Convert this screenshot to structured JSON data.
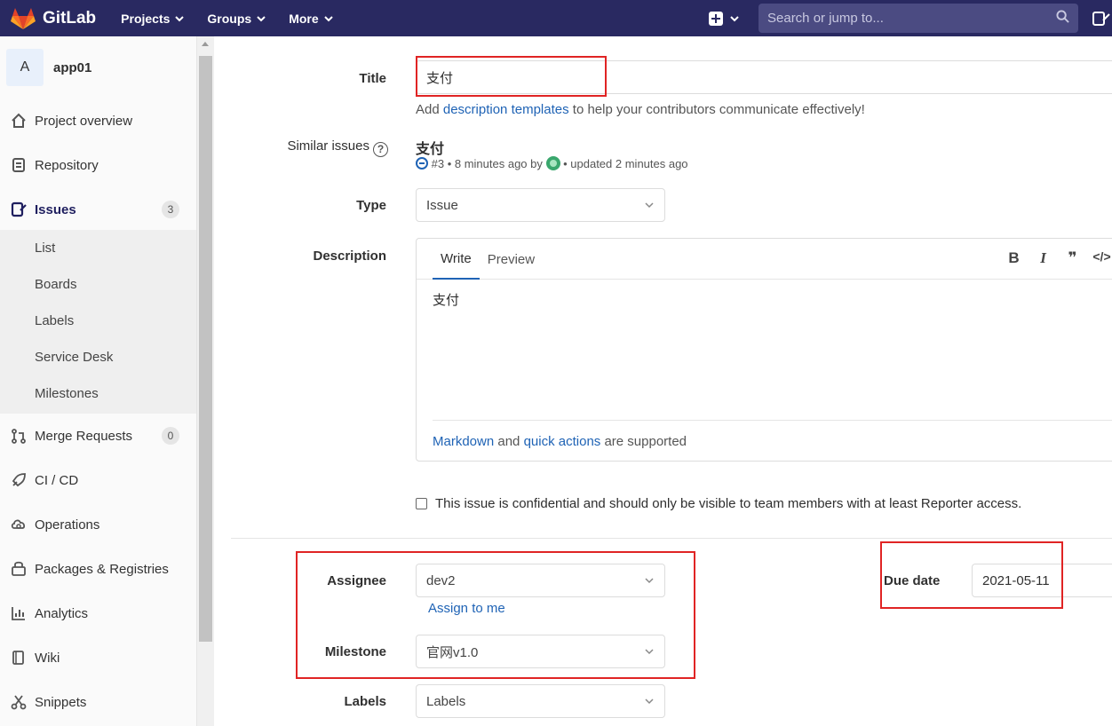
{
  "navbar": {
    "brand": "GitLab",
    "menu": [
      {
        "label": "Projects"
      },
      {
        "label": "Groups"
      },
      {
        "label": "More"
      }
    ],
    "search_placeholder": "Search or jump to...",
    "brand_color": "#292961"
  },
  "sidebar": {
    "project_avatar": "A",
    "project_name": "app01",
    "items": [
      {
        "label": "Project overview",
        "icon": "home-icon"
      },
      {
        "label": "Repository",
        "icon": "doc-icon"
      },
      {
        "label": "Issues",
        "icon": "issues-icon",
        "badge": "3"
      },
      {
        "label": "Merge Requests",
        "icon": "merge-icon",
        "badge": "0"
      },
      {
        "label": "CI / CD",
        "icon": "rocket-icon"
      },
      {
        "label": "Operations",
        "icon": "cloud-icon"
      },
      {
        "label": "Packages & Registries",
        "icon": "package-icon"
      },
      {
        "label": "Analytics",
        "icon": "chart-icon"
      },
      {
        "label": "Wiki",
        "icon": "book-icon"
      },
      {
        "label": "Snippets",
        "icon": "scissors-icon"
      }
    ],
    "issues_sub": [
      "List",
      "Boards",
      "Labels",
      "Service Desk",
      "Milestones"
    ]
  },
  "form": {
    "title_label": "Title",
    "title_value": "支付",
    "templates_prefix": "Add ",
    "templates_link": "description templates",
    "templates_suffix": " to help your contributors communicate effectively!",
    "similar_label": "Similar issues",
    "similar_title": "支付",
    "similar_meta_num": "#3",
    "similar_meta_time": " • 8 minutes ago by ",
    "similar_meta_updated": " • updated 2 minutes ago",
    "type_label": "Type",
    "type_value": "Issue",
    "description_label": "Description",
    "tab_write": "Write",
    "tab_preview": "Preview",
    "tool_bold": "B",
    "tool_italic": "I",
    "tool_quote": "❞",
    "tool_code": "</>",
    "description_value": "支付",
    "markdown_link": "Markdown",
    "and_text": " and ",
    "quick_actions_link": "quick actions",
    "supported_text": " are supported",
    "confidential_text": "This issue is confidential and should only be visible to team members with at least Reporter access.",
    "assignee_label": "Assignee",
    "assignee_value": "dev2",
    "assign_to_me": "Assign to me",
    "milestone_label": "Milestone",
    "milestone_value": "官网v1.0",
    "labels_label": "Labels",
    "labels_value": "Labels",
    "due_label": "Due date",
    "due_value": "2021-05-11"
  }
}
